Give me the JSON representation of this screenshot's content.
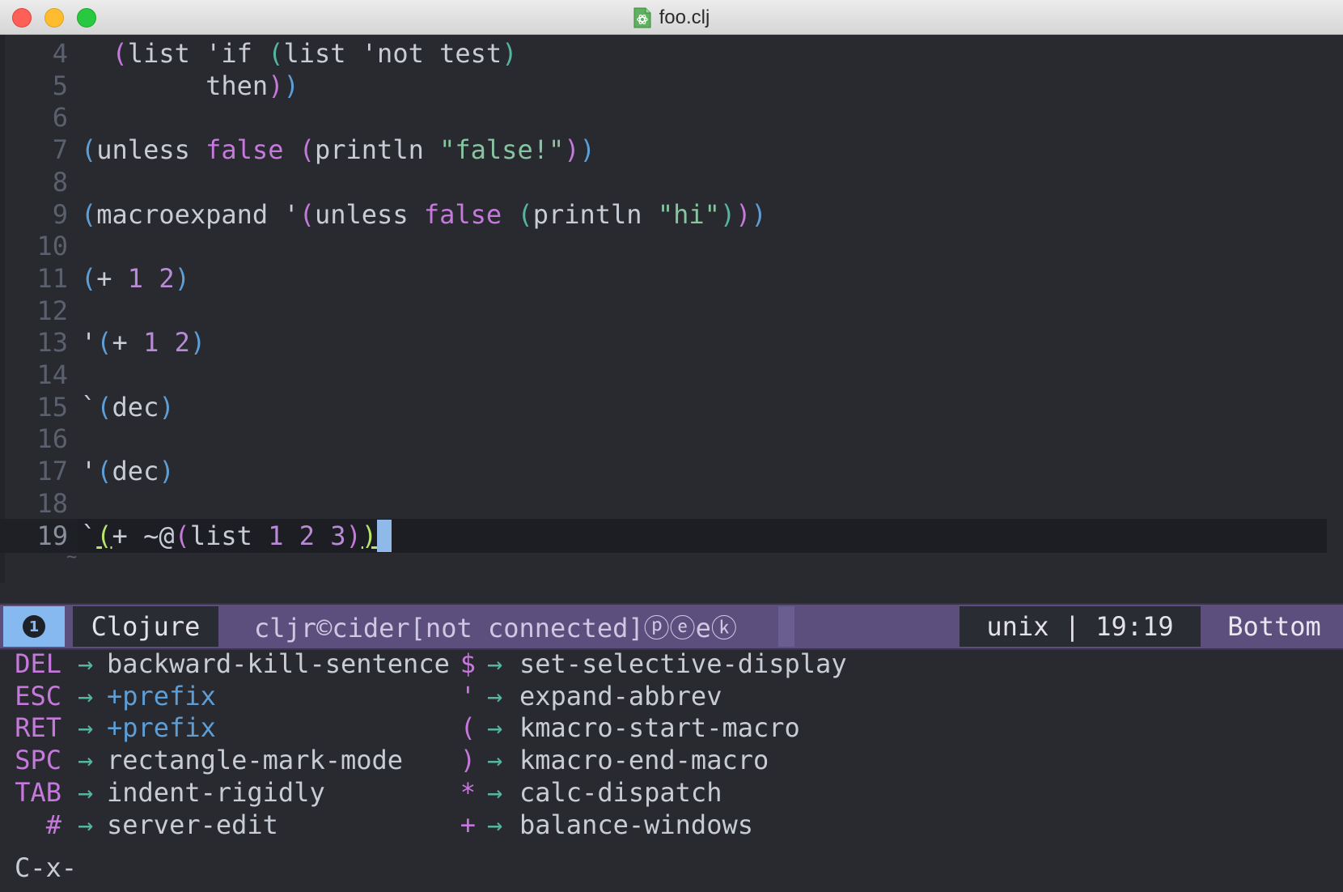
{
  "window": {
    "title": "foo.clj"
  },
  "editor": {
    "lines": [
      {
        "num": "4",
        "tokens": [
          {
            "t": "  ",
            "c": "c-q"
          },
          {
            "t": "(",
            "c": "c-p2"
          },
          {
            "t": "list ",
            "c": "c-q"
          },
          {
            "t": "'if ",
            "c": "c-q"
          },
          {
            "t": "(",
            "c": "c-p3"
          },
          {
            "t": "list ",
            "c": "c-q"
          },
          {
            "t": "'not test",
            "c": "c-q"
          },
          {
            "t": ")",
            "c": "c-p3"
          }
        ]
      },
      {
        "num": "5",
        "tokens": [
          {
            "t": "        then",
            "c": "c-q"
          },
          {
            "t": ")",
            "c": "c-p2"
          },
          {
            "t": ")",
            "c": "c-p1"
          }
        ]
      },
      {
        "num": "6",
        "tokens": []
      },
      {
        "num": "7",
        "tokens": [
          {
            "t": "(",
            "c": "c-p1"
          },
          {
            "t": "unless ",
            "c": "c-q"
          },
          {
            "t": "false ",
            "c": "c-kw"
          },
          {
            "t": "(",
            "c": "c-p2"
          },
          {
            "t": "println ",
            "c": "c-q"
          },
          {
            "t": "\"false!\"",
            "c": "c-str"
          },
          {
            "t": ")",
            "c": "c-p2"
          },
          {
            "t": ")",
            "c": "c-p1"
          }
        ]
      },
      {
        "num": "8",
        "tokens": []
      },
      {
        "num": "9",
        "tokens": [
          {
            "t": "(",
            "c": "c-p1"
          },
          {
            "t": "macroexpand ",
            "c": "c-q"
          },
          {
            "t": "'",
            "c": "c-q"
          },
          {
            "t": "(",
            "c": "c-p2"
          },
          {
            "t": "unless ",
            "c": "c-q"
          },
          {
            "t": "false ",
            "c": "c-kw"
          },
          {
            "t": "(",
            "c": "c-p3"
          },
          {
            "t": "println ",
            "c": "c-q"
          },
          {
            "t": "\"hi\"",
            "c": "c-str"
          },
          {
            "t": ")",
            "c": "c-p3"
          },
          {
            "t": ")",
            "c": "c-p2"
          },
          {
            "t": ")",
            "c": "c-p1"
          }
        ]
      },
      {
        "num": "10",
        "tokens": []
      },
      {
        "num": "11",
        "tokens": [
          {
            "t": "(",
            "c": "c-p1"
          },
          {
            "t": "+ ",
            "c": "c-q"
          },
          {
            "t": "1 2",
            "c": "c-num"
          },
          {
            "t": ")",
            "c": "c-p1"
          }
        ]
      },
      {
        "num": "12",
        "tokens": []
      },
      {
        "num": "13",
        "tokens": [
          {
            "t": "'",
            "c": "c-q"
          },
          {
            "t": "(",
            "c": "c-p1"
          },
          {
            "t": "+ ",
            "c": "c-q"
          },
          {
            "t": "1 2",
            "c": "c-num"
          },
          {
            "t": ")",
            "c": "c-p1"
          }
        ]
      },
      {
        "num": "14",
        "tokens": []
      },
      {
        "num": "15",
        "tokens": [
          {
            "t": "`",
            "c": "c-q"
          },
          {
            "t": "(",
            "c": "c-p1"
          },
          {
            "t": "dec",
            "c": "c-q"
          },
          {
            "t": ")",
            "c": "c-p1"
          }
        ]
      },
      {
        "num": "16",
        "tokens": []
      },
      {
        "num": "17",
        "tokens": [
          {
            "t": "'",
            "c": "c-q"
          },
          {
            "t": "(",
            "c": "c-p1"
          },
          {
            "t": "dec",
            "c": "c-q"
          },
          {
            "t": ")",
            "c": "c-p1"
          }
        ]
      },
      {
        "num": "18",
        "tokens": []
      },
      {
        "num": "19",
        "current": true,
        "tokens": [
          {
            "t": "`",
            "c": "c-q"
          },
          {
            "t": "(",
            "c": "c-hl"
          },
          {
            "t": "+ ~@",
            "c": "c-q"
          },
          {
            "t": "(",
            "c": "c-p2"
          },
          {
            "t": "list ",
            "c": "c-q"
          },
          {
            "t": "1 2 3",
            "c": "c-num"
          },
          {
            "t": ")",
            "c": "c-p2"
          },
          {
            "t": ")",
            "c": "c-hl"
          }
        ]
      }
    ],
    "tilde": "~"
  },
  "modeline": {
    "window_number": "1",
    "major_mode": "Clojure",
    "minor_modes": "cljr©cider[not connected]ⓟⓔeⓚ",
    "position": "unix | 19:19",
    "scroll": "Bottom"
  },
  "whichkey": {
    "left": [
      {
        "key": "DEL",
        "cmd": "backward-kill-sentence",
        "prefix": false
      },
      {
        "key": "ESC",
        "cmd": "+prefix",
        "prefix": true
      },
      {
        "key": "RET",
        "cmd": "+prefix",
        "prefix": true
      },
      {
        "key": "SPC",
        "cmd": "rectangle-mark-mode",
        "prefix": false
      },
      {
        "key": "TAB",
        "cmd": "indent-rigidly",
        "prefix": false
      },
      {
        "key": "#",
        "cmd": "server-edit",
        "prefix": false
      }
    ],
    "right": [
      {
        "key": "$",
        "cmd": "set-selective-display",
        "prefix": false
      },
      {
        "key": "'",
        "cmd": "expand-abbrev",
        "prefix": false
      },
      {
        "key": "(",
        "cmd": "kmacro-start-macro",
        "prefix": false
      },
      {
        "key": ")",
        "cmd": "kmacro-end-macro",
        "prefix": false
      },
      {
        "key": "*",
        "cmd": "calc-dispatch",
        "prefix": false
      },
      {
        "key": "+",
        "cmd": "balance-windows",
        "prefix": false
      }
    ],
    "arrow": "→",
    "echo": "C-x-"
  }
}
